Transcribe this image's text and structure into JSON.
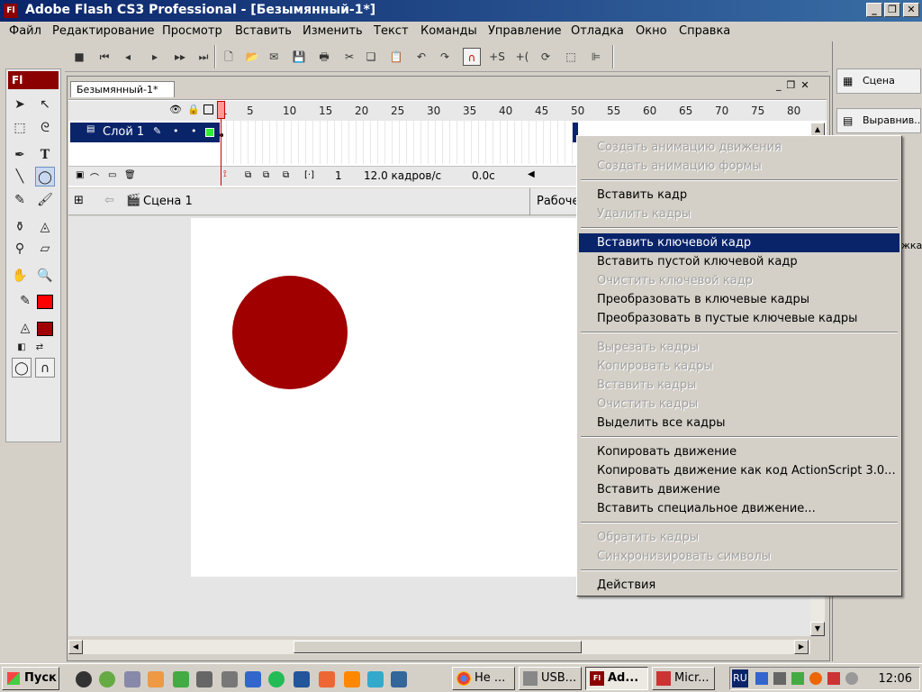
{
  "window": {
    "title": "Adobe Flash CS3 Professional - [Безымянный-1*]",
    "app_icon": "Fl"
  },
  "menubar": [
    "Файл",
    "Редактирование",
    "Просмотр",
    "Вставить",
    "Изменить",
    "Текст",
    "Команды",
    "Управление",
    "Отладка",
    "Окно",
    "Справка"
  ],
  "tools": {
    "logo": "Fl"
  },
  "document": {
    "tab": "Безымянный-1*"
  },
  "timeline": {
    "layer_name": "Слой 1",
    "ruler": [
      "1",
      "5",
      "10",
      "15",
      "20",
      "25",
      "30",
      "35",
      "40",
      "45",
      "50",
      "55",
      "60",
      "65",
      "70",
      "75",
      "80"
    ],
    "current_frame": "1",
    "fps": "12.0 кадров/с",
    "time": "0.0с"
  },
  "editbar": {
    "scene": "Сцена 1",
    "workspace": "Рабоче"
  },
  "stage": {
    "circle_color": "#a00000"
  },
  "right_panel": {
    "scene": "Сцена",
    "align": "Выравнив...",
    "partial": "жка"
  },
  "context_menu": {
    "groups": [
      [
        {
          "label": "Создать анимацию движения",
          "enabled": false
        },
        {
          "label": "Создать анимацию формы",
          "enabled": false
        }
      ],
      [
        {
          "label": "Вставить кадр",
          "enabled": true
        },
        {
          "label": "Удалить кадры",
          "enabled": false
        }
      ],
      [
        {
          "label": "Вставить ключевой кадр",
          "enabled": true,
          "highlighted": true
        },
        {
          "label": "Вставить пустой ключевой кадр",
          "enabled": true
        },
        {
          "label": "Очистить ключевой кадр",
          "enabled": false
        },
        {
          "label": "Преобразовать в ключевые кадры",
          "enabled": true
        },
        {
          "label": "Преобразовать в пустые ключевые кадры",
          "enabled": true
        }
      ],
      [
        {
          "label": "Вырезать кадры",
          "enabled": false
        },
        {
          "label": "Копировать кадры",
          "enabled": false
        },
        {
          "label": "Вставить кадры",
          "enabled": false
        },
        {
          "label": "Очистить кадры",
          "enabled": false
        },
        {
          "label": "Выделить все кадры",
          "enabled": true
        }
      ],
      [
        {
          "label": "Копировать движение",
          "enabled": true
        },
        {
          "label": "Копировать движение как код ActionScript 3.0...",
          "enabled": true
        },
        {
          "label": "Вставить движение",
          "enabled": true
        },
        {
          "label": "Вставить специальное движение...",
          "enabled": true
        }
      ],
      [
        {
          "label": "Обратить кадры",
          "enabled": false
        },
        {
          "label": "Синхронизировать символы",
          "enabled": false
        }
      ],
      [
        {
          "label": "Действия",
          "enabled": true
        }
      ]
    ]
  },
  "taskbar": {
    "start": "Пуск",
    "tasks": [
      {
        "label": "Не ...",
        "icon": "chrome-icon",
        "active": false
      },
      {
        "label": "USB...",
        "icon": "usb-icon",
        "active": false
      },
      {
        "label": "Ad...",
        "icon": "flash-icon",
        "active": true
      },
      {
        "label": "Micr...",
        "icon": "paint-icon",
        "active": false
      }
    ],
    "lang": "RU",
    "clock": "12:06"
  },
  "colors": {
    "title_bar": "#0a246a",
    "highlight": "#0a246a",
    "fill_red": "#ff0000",
    "stroke_red": "#cc0000"
  }
}
